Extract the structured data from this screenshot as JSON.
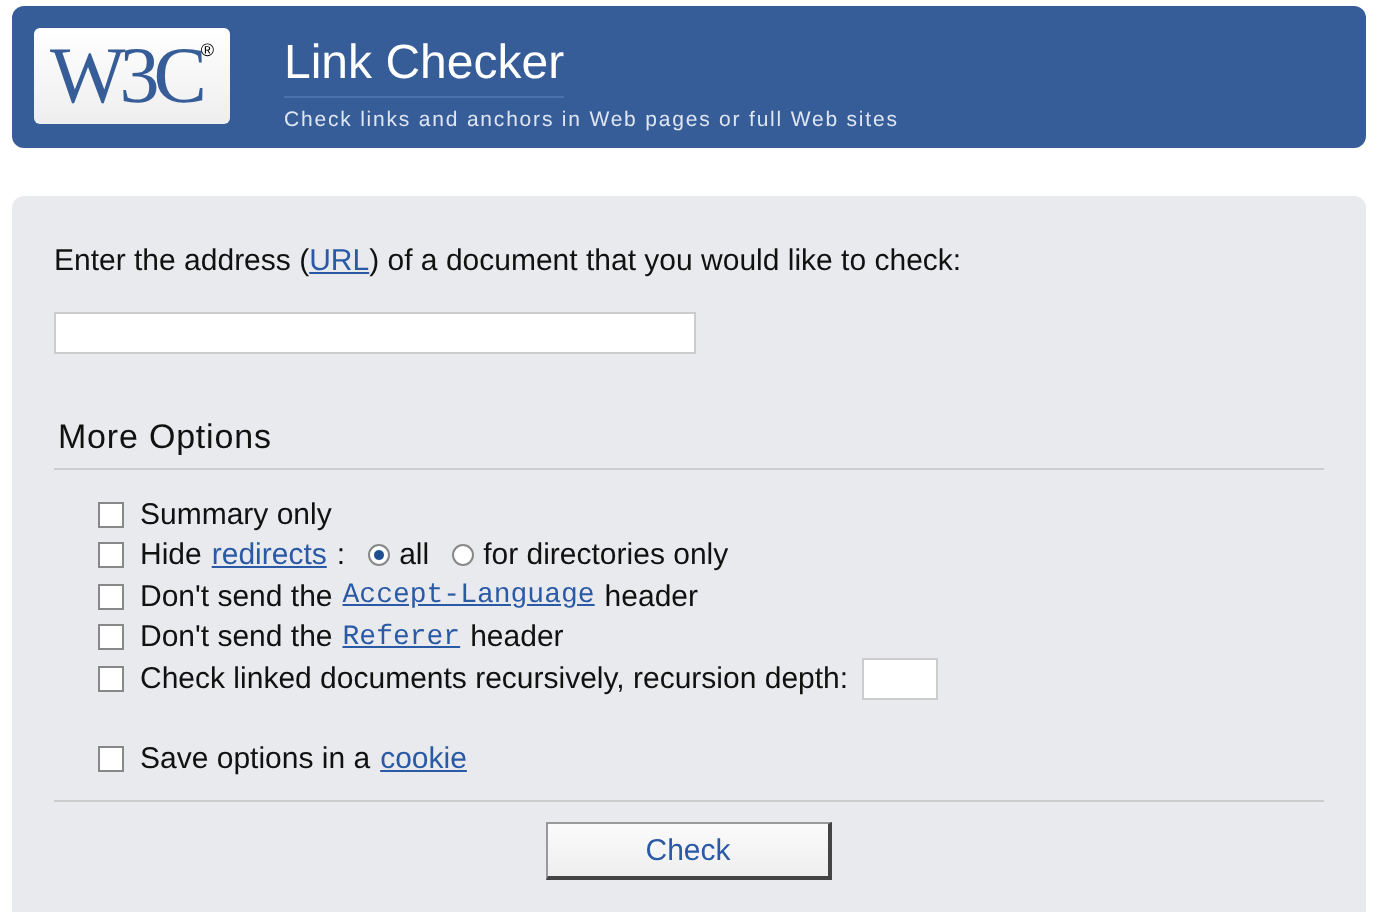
{
  "header": {
    "logo": {
      "text": "W3C",
      "mark": "®"
    },
    "title": "Link Checker",
    "subtitle": "Check links and anchors in Web pages or full Web sites"
  },
  "prompt": {
    "before": "Enter the address (",
    "link": "URL",
    "after": ") of a document that you would like to check:"
  },
  "more_options": {
    "heading": "More Options",
    "options": [
      {
        "checked": false,
        "parts": [
          {
            "kind": "text",
            "text": "Summary only"
          }
        ]
      },
      {
        "checked": false,
        "parts": [
          {
            "kind": "text",
            "text": "Hide"
          },
          {
            "kind": "link",
            "text": "redirects"
          },
          {
            "kind": "text",
            "text": ":"
          },
          {
            "kind": "radio",
            "text": "all",
            "selected": true
          },
          {
            "kind": "radio",
            "text": "for directories only",
            "selected": false
          }
        ]
      },
      {
        "checked": false,
        "parts": [
          {
            "kind": "text",
            "text": "Don't send the"
          },
          {
            "kind": "code",
            "text": "Accept-Language"
          },
          {
            "kind": "text",
            "text": "header"
          }
        ]
      },
      {
        "checked": false,
        "parts": [
          {
            "kind": "text",
            "text": "Don't send the"
          },
          {
            "kind": "code",
            "text": "Referer"
          },
          {
            "kind": "text",
            "text": "header"
          }
        ]
      },
      {
        "checked": false,
        "parts": [
          {
            "kind": "text",
            "text": "Check linked documents recursively, recursion depth:"
          },
          {
            "kind": "input"
          }
        ]
      }
    ],
    "save_options": [
      {
        "checked": false,
        "parts": [
          {
            "kind": "text",
            "text": "Save options in a"
          },
          {
            "kind": "link",
            "text": "cookie"
          }
        ]
      }
    ]
  },
  "submit": "Check"
}
